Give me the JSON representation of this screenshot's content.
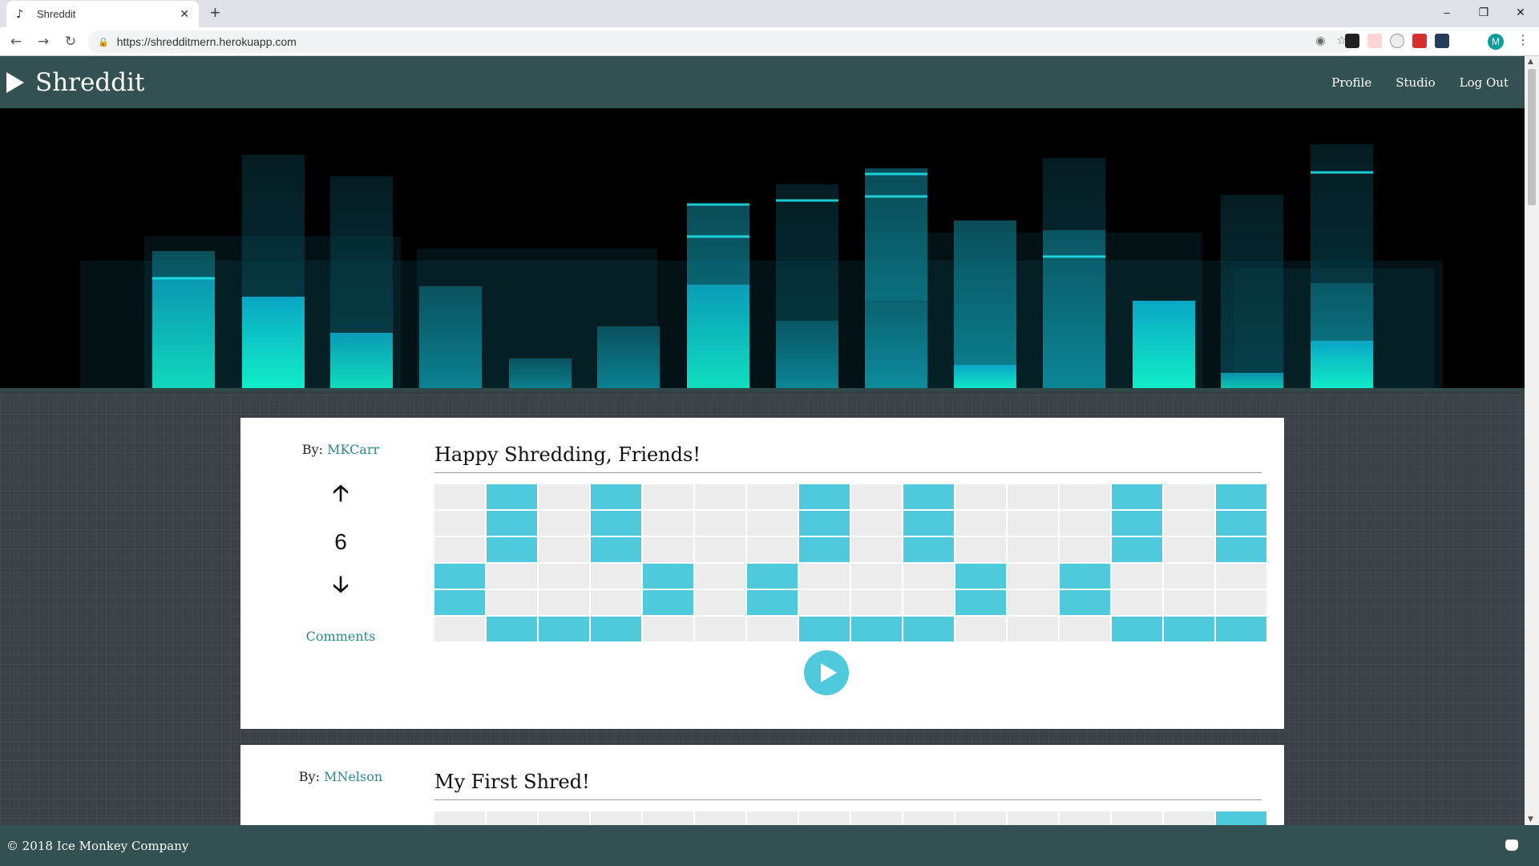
{
  "browser": {
    "tab_title": "Shreddit",
    "tab_icon": "music-note-icon",
    "url": "https://shredditmern.herokuapp.com",
    "profile_initial": "M"
  },
  "app": {
    "brand": "Shreddit",
    "nav": [
      "Profile",
      "Studio",
      "Log Out"
    ],
    "footer": "© 2018 Ice Monkey Company",
    "accent_color": "#4fc9dc",
    "header_color": "#335150"
  },
  "posts": [
    {
      "by_label": "By:",
      "author": "MKCarr",
      "title": "Happy Shredding, Friends!",
      "score": "6",
      "comments": "Comments",
      "grid": [
        [
          0,
          1,
          0,
          1,
          0,
          0,
          0,
          1,
          0,
          1,
          0,
          0,
          0,
          1,
          0,
          1
        ],
        [
          0,
          1,
          0,
          1,
          0,
          0,
          0,
          1,
          0,
          1,
          0,
          0,
          0,
          1,
          0,
          1
        ],
        [
          0,
          1,
          0,
          1,
          0,
          0,
          0,
          1,
          0,
          1,
          0,
          0,
          0,
          1,
          0,
          1
        ],
        [
          1,
          0,
          0,
          0,
          1,
          0,
          1,
          0,
          0,
          0,
          1,
          0,
          1,
          0,
          0,
          0
        ],
        [
          1,
          0,
          0,
          0,
          1,
          0,
          1,
          0,
          0,
          0,
          1,
          0,
          1,
          0,
          0,
          0
        ],
        [
          0,
          1,
          1,
          1,
          0,
          0,
          0,
          1,
          1,
          1,
          0,
          0,
          0,
          1,
          1,
          1
        ]
      ]
    },
    {
      "by_label": "By:",
      "author": "MNelson",
      "title": "My First Shred!",
      "grid": [
        [
          0,
          0,
          0,
          0,
          0,
          0,
          0,
          0,
          0,
          0,
          0,
          0,
          0,
          0,
          0,
          1
        ]
      ]
    }
  ]
}
